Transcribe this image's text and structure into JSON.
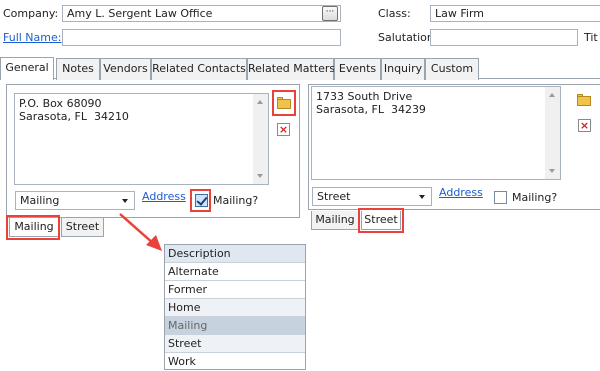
{
  "header": {
    "company_label": "Company:",
    "company_value": "Amy L. Sergent Law Office",
    "ellipsis_label": "···",
    "fullname_label": "Full Name:",
    "fullname_value": "",
    "class_label": "Class:",
    "class_value": "Law Firm",
    "salutation_label": "Salutation:",
    "salutation_value": "",
    "title_label": "Tit"
  },
  "tabs": [
    "General",
    "Notes",
    "Vendors",
    "Related Contacts",
    "Related Matters",
    "Events",
    "Inquiry",
    "Custom"
  ],
  "active_tab": "General",
  "left_address": {
    "text": "P.O. Box 68090\nSarasota, FL  34210",
    "type_value": "Mailing",
    "address_link": "Address",
    "mailing_label": "Mailing?",
    "mailing_checked": true,
    "subtabs": [
      "Mailing",
      "Street"
    ],
    "active_subtab": "Mailing"
  },
  "right_address": {
    "text": "1733 South Drive\nSarasota, FL  34239",
    "type_value": "Street",
    "address_link": "Address",
    "mailing_label": "Mailing?",
    "mailing_checked": false,
    "subtabs": [
      "Mailing",
      "Street"
    ],
    "active_subtab": "Street"
  },
  "type_dropdown": {
    "header": "Description",
    "options": [
      "Alternate",
      "Former",
      "Home",
      "Mailing",
      "Street",
      "Work"
    ],
    "selected": "Mailing"
  },
  "colors": {
    "highlight": "#e8423a",
    "link": "#1a5fd0",
    "dropdown_header_bg": "#dfe7f1",
    "dropdown_selected_bg": "#c7d2df"
  },
  "icons": {
    "add": "folder-add-icon",
    "delete": "delete-icon",
    "dropdown": "chevron-down-icon"
  }
}
